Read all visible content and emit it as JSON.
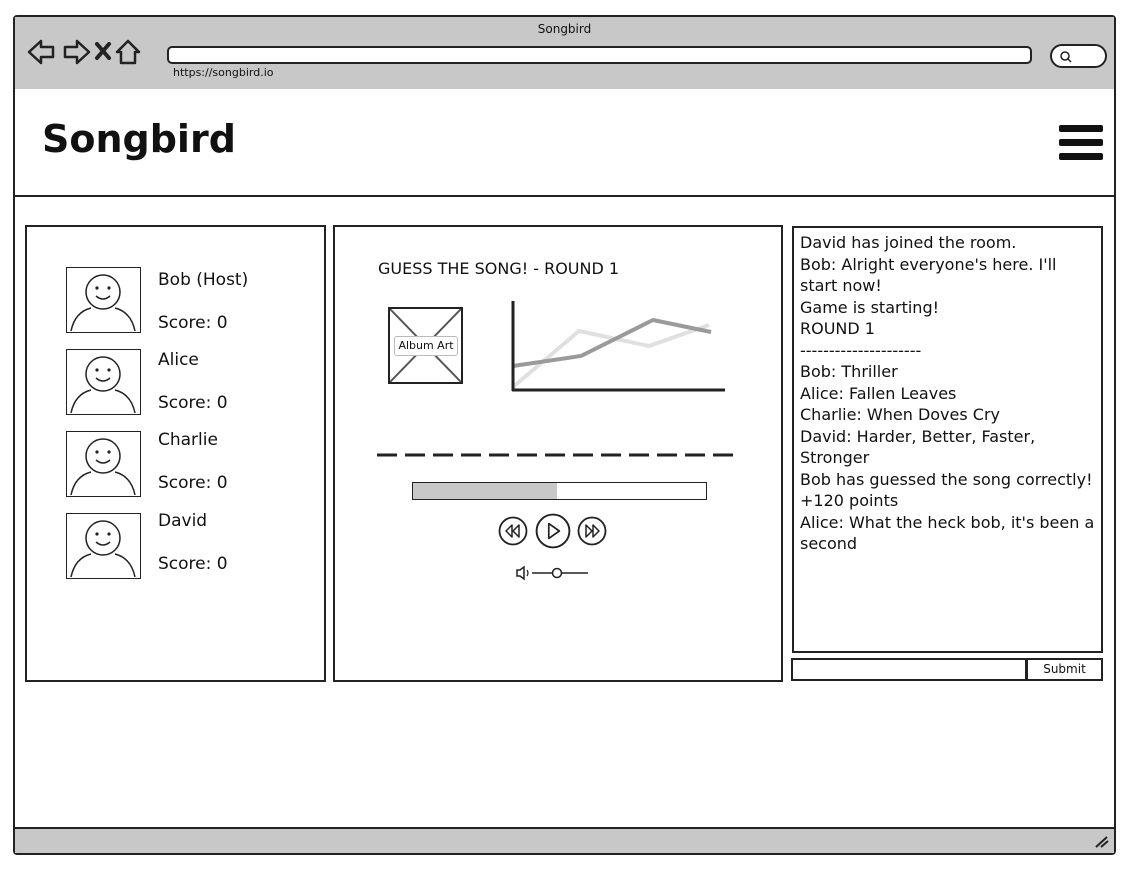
{
  "window": {
    "title": "Songbird"
  },
  "browser": {
    "url": "https://songbird.io"
  },
  "header": {
    "brand": "Songbird"
  },
  "players": [
    {
      "name": "Bob (Host)",
      "score": "Score: 0"
    },
    {
      "name": "Alice",
      "score": "Score: 0"
    },
    {
      "name": "Charlie",
      "score": "Score: 0"
    },
    {
      "name": "David",
      "score": "Score: 0"
    }
  ],
  "game": {
    "round_title": "GUESS THE SONG! - ROUND 1",
    "album_label": "Album Art",
    "progress": 0.49
  },
  "chat": {
    "lines": [
      "David has joined the room.",
      "Bob: Alright everyone's here. I'll start now!",
      "",
      "Game is starting!",
      "ROUND 1",
      "---------------------",
      "",
      "Bob: Thriller",
      "Alice: Fallen Leaves",
      "Charlie: When Doves Cry",
      "David: Harder, Better, Faster, Stronger",
      "",
      "Bob has guessed the song correctly! +120 points",
      "",
      "Alice: What the heck bob, it's been a second"
    ],
    "input_value": "",
    "submit_label": "Submit"
  }
}
